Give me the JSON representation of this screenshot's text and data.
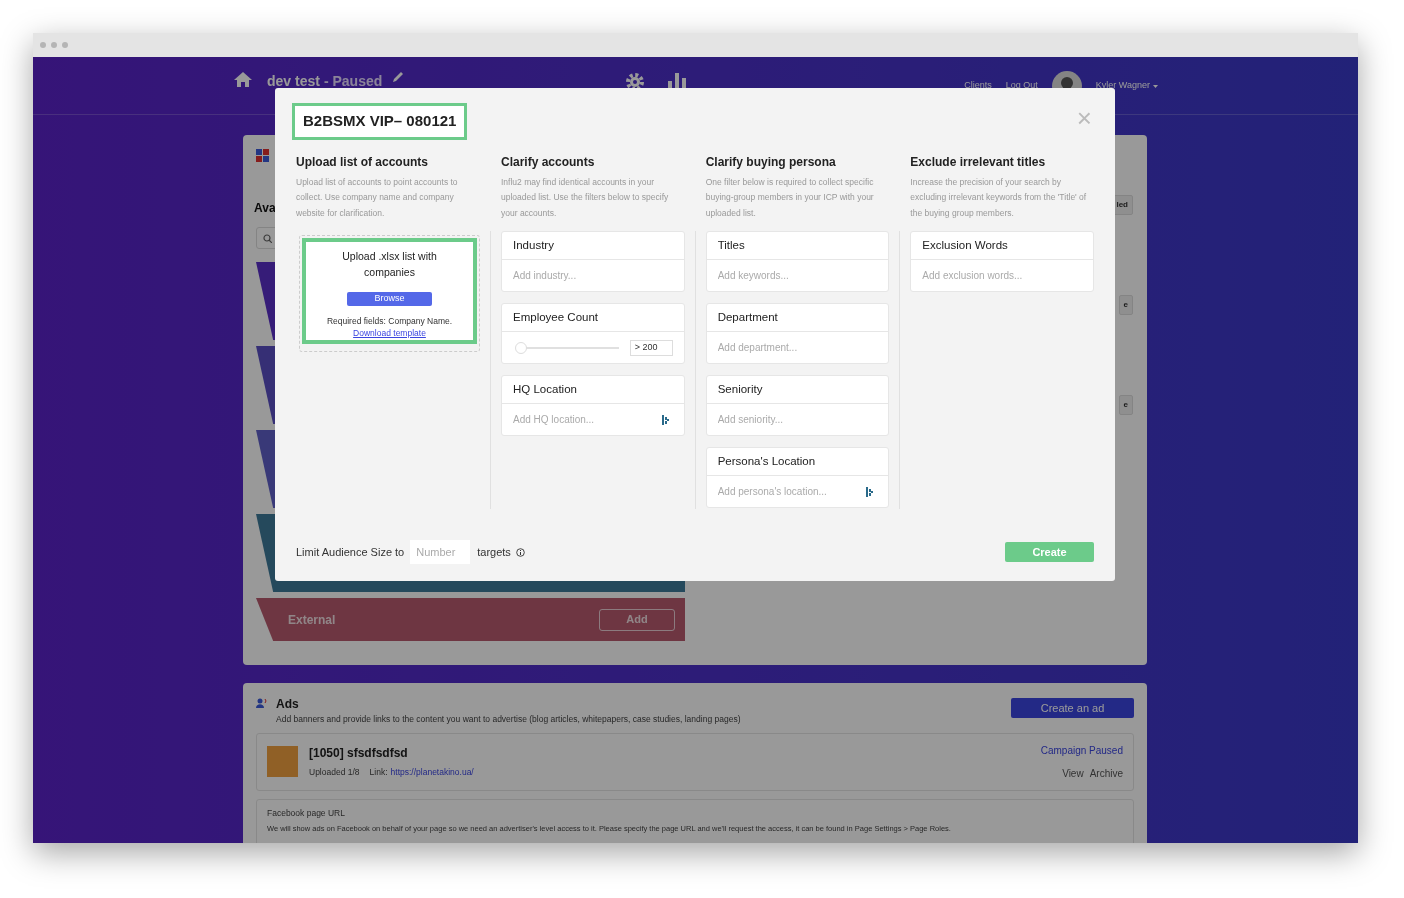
{
  "navbar": {
    "project": "dev test",
    "status": "- Paused",
    "links": [
      "Clients",
      "Log Out"
    ],
    "user": "Kyler Wagner"
  },
  "background": {
    "section_title": "Ava",
    "funnel_stage": {
      "label": "External",
      "button": "Add"
    },
    "right_fragments": [
      "led",
      "e",
      "e"
    ]
  },
  "ads": {
    "title": "Ads",
    "description": "Add banners and provide links to the content you want to advertise (blog articles, whitepapers, case studies, landing pages)",
    "button": "Create an ad",
    "ad": {
      "name": "[1050] sfsdfsdfsd",
      "uploaded": "Uploaded 1/8",
      "link_label": "Link:",
      "link": "https://planetakino.ua/",
      "status": "Campaign Paused",
      "actions": [
        "View",
        "Archive"
      ]
    },
    "facebook": {
      "title": "Facebook page URL",
      "description": "We will show ads on Facebook on behalf of your page so we need an advertiser's level access to it. Please specify the page URL and we'll request the access, it can be found in Page Settings > Page Roles."
    }
  },
  "modal": {
    "title": "B2BSMX VIP– 080121",
    "close": "×",
    "columns": [
      {
        "title": "Upload list of accounts",
        "description": "Upload list of accounts to point accounts to collect. Use company name and company website for clarification.",
        "kind": "upload",
        "upload": {
          "text": "Upload .xlsx list with companies",
          "button": "Browse",
          "required": "Required fields: Company Name.",
          "link": "Download template"
        }
      },
      {
        "title": "Clarify accounts",
        "description": "Influ2 may find identical accounts in your uploaded list. Use the filters below to specify your accounts.",
        "kind": "filters",
        "filters": [
          {
            "label": "Industry",
            "kind": "text",
            "placeholder": "Add industry..."
          },
          {
            "label": "Employee Count",
            "kind": "slider",
            "level": 0.02,
            "value": "> 200"
          },
          {
            "label": "HQ Location",
            "kind": "location",
            "placeholder": "Add HQ location..."
          }
        ]
      },
      {
        "title": "Clarify buying persona",
        "description": "One filter below is required to collect specific buying-group members in your ICP with your uploaded list.",
        "kind": "filters",
        "filters": [
          {
            "label": "Titles",
            "kind": "text",
            "placeholder": "Add keywords..."
          },
          {
            "label": "Department",
            "kind": "text",
            "placeholder": "Add department..."
          },
          {
            "label": "Seniority",
            "kind": "text",
            "placeholder": "Add seniority..."
          },
          {
            "label": "Persona's Location",
            "kind": "location",
            "placeholder": "Add persona's location..."
          }
        ]
      },
      {
        "title": "Exclude irrelevant titles",
        "description": "Increase the precision of your search by excluding irrelevant keywords from the 'Title' of the buying group members.",
        "kind": "filters",
        "filters": [
          {
            "label": "Exclusion Words",
            "kind": "text",
            "placeholder": "Add exclusion words..."
          }
        ]
      }
    ],
    "footer": {
      "label": "Limit Audience Size to",
      "placeholder": "Number",
      "suffix": "targets",
      "button": "Create"
    }
  }
}
